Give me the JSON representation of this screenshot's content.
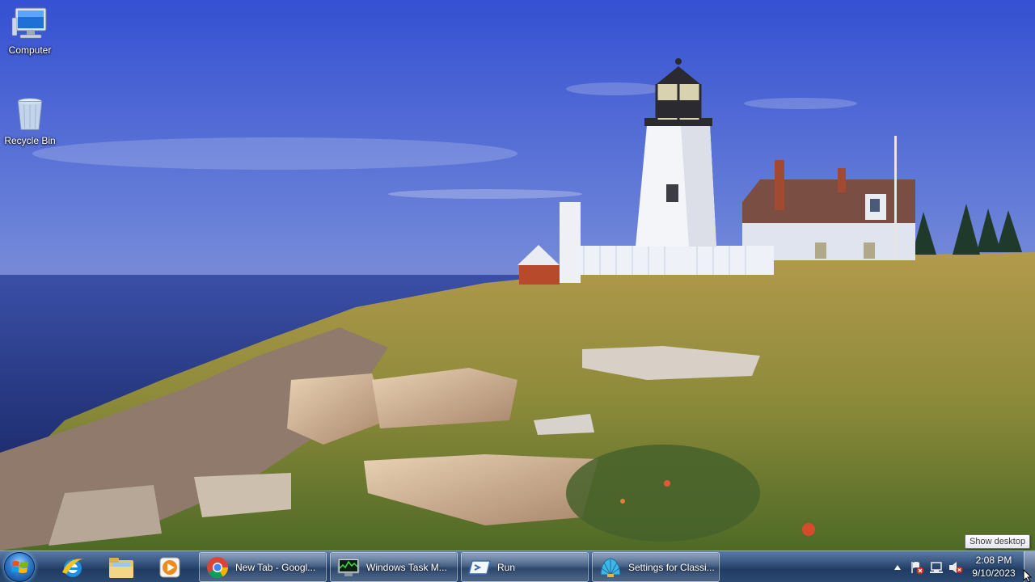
{
  "desktop": {
    "icons": [
      {
        "label": "Computer",
        "icon": "computer-icon"
      },
      {
        "label": "Recycle Bin",
        "icon": "recycle-bin-icon"
      }
    ]
  },
  "taskbar": {
    "pinned": [
      {
        "name": "Internet Explorer",
        "icon": "internet-explorer-icon"
      },
      {
        "name": "Windows Explorer",
        "icon": "folder-icon"
      },
      {
        "name": "Windows Media Player",
        "icon": "media-player-icon"
      }
    ],
    "tasks": [
      {
        "label": "New Tab - Googl...",
        "icon": "chrome-icon"
      },
      {
        "label": "Windows Task M...",
        "icon": "task-manager-icon"
      },
      {
        "label": "Run",
        "icon": "run-icon"
      },
      {
        "label": "Settings for Classi...",
        "icon": "shell-icon"
      }
    ],
    "tray": {
      "icons": [
        "show-hidden-icons-arrow",
        "action-center-flag-icon",
        "network-icon",
        "volume-muted-icon"
      ]
    },
    "clock": {
      "time": "2:08 PM",
      "date": "9/10/2023"
    }
  },
  "tooltip": {
    "text": "Show desktop"
  },
  "colors": {
    "taskbar": "#2b4a72",
    "sky_top": "#3f5fd6",
    "sea": "#2a3f8c"
  }
}
